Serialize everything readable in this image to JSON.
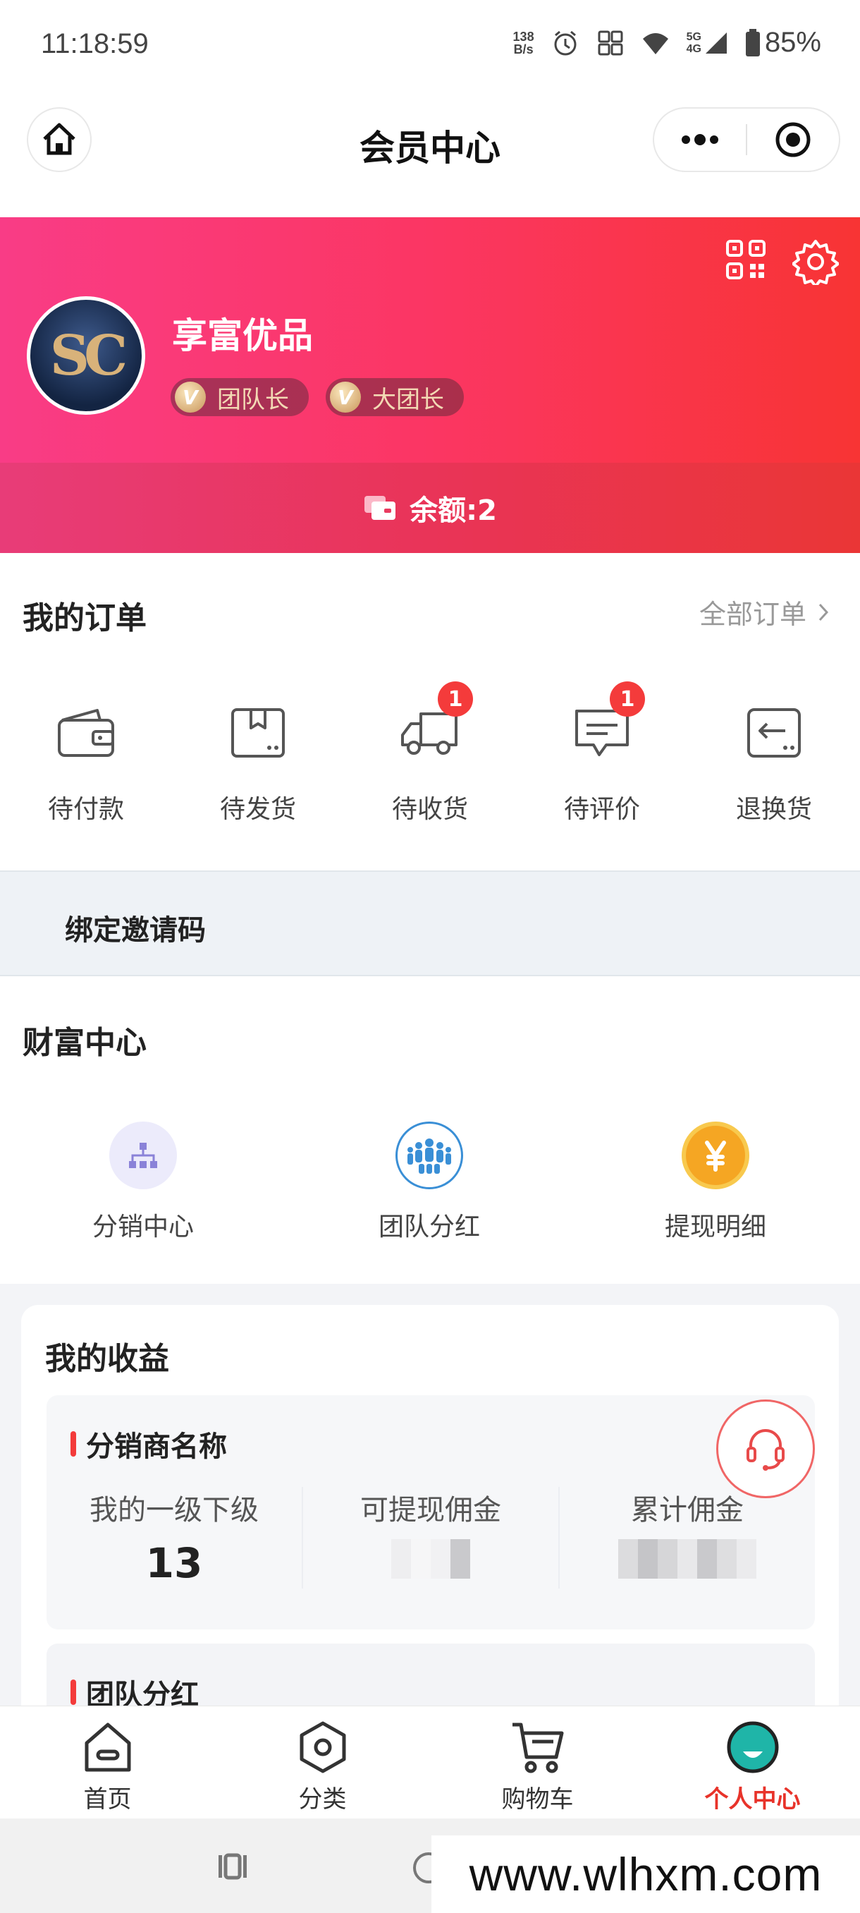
{
  "status_bar": {
    "time": "11:18:59",
    "net_speed_value": "138",
    "net_speed_unit": "B/s",
    "network": "5G",
    "network_sub": "4G",
    "battery": "85%"
  },
  "nav": {
    "title": "会员中心",
    "home_icon": "home-icon",
    "more_icon": "more-dots-icon",
    "close_icon": "target-close-icon"
  },
  "profile": {
    "avatar_text": "SC",
    "name": "享富优品",
    "badges": [
      {
        "icon": "V",
        "label": "团队长"
      },
      {
        "icon": "V",
        "label": "大团长"
      }
    ],
    "balance": "余额:2"
  },
  "orders": {
    "title": "我的订单",
    "all_link": "全部订单",
    "items": [
      {
        "label": "待付款",
        "icon": "wallet-icon",
        "badge": ""
      },
      {
        "label": "待发货",
        "icon": "box-icon",
        "badge": ""
      },
      {
        "label": "待收货",
        "icon": "truck-icon",
        "badge": "1"
      },
      {
        "label": "待评价",
        "icon": "comment-icon",
        "badge": "1"
      },
      {
        "label": "退换货",
        "icon": "return-icon",
        "badge": ""
      }
    ]
  },
  "invite": {
    "label": "绑定邀请码"
  },
  "wealth": {
    "title": "财富中心",
    "items": [
      {
        "label": "分销中心",
        "icon": "hierarchy-icon"
      },
      {
        "label": "团队分红",
        "icon": "team-icon"
      },
      {
        "label": "提现明细",
        "icon": "yen-coin-icon"
      }
    ]
  },
  "earnings": {
    "title": "我的收益",
    "distributor": {
      "title": "分销商名称",
      "stats": [
        {
          "label": "我的一级下级",
          "value": "13"
        },
        {
          "label": "可提现佣金",
          "value": ""
        },
        {
          "label": "累计佣金",
          "value": ""
        }
      ]
    },
    "team": {
      "title": "团队分红"
    }
  },
  "tabbar": {
    "items": [
      {
        "label": "首页",
        "icon": "home-tab-icon",
        "active": false
      },
      {
        "label": "分类",
        "icon": "category-icon",
        "active": false
      },
      {
        "label": "购物车",
        "icon": "cart-icon",
        "active": false
      },
      {
        "label": "个人中心",
        "icon": "profile-icon",
        "active": true
      }
    ]
  },
  "watermark": "www.wlhxm.com",
  "colors": {
    "accent": "#e8332a",
    "banner_start": "#f93c86",
    "banner_end": "#f83434",
    "badge_red": "#f43b3b"
  }
}
